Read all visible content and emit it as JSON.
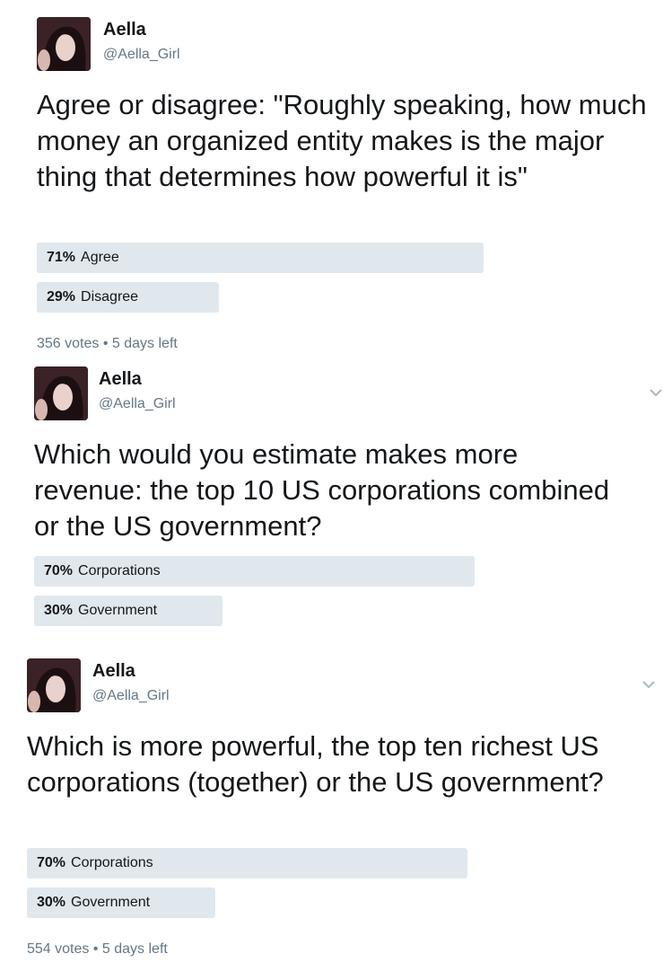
{
  "tweets": [
    {
      "author": {
        "name": "Aella",
        "handle": "@Aella_Girl"
      },
      "question": "Agree or disagree: \"Roughly speaking, how much money an organized entity makes is the major thing that determines how powerful it is\"",
      "options": [
        {
          "percent": "71%",
          "fraction": 0.71,
          "label": "Agree"
        },
        {
          "percent": "29%",
          "fraction": 0.29,
          "label": "Disagree"
        }
      ],
      "votes": "356 votes",
      "time_left": "5 days left",
      "has_caret": false
    },
    {
      "author": {
        "name": "Aella",
        "handle": "@Aella_Girl"
      },
      "question": "Which would you estimate makes more revenue: the top 10 US corporations combined or the US government?",
      "options": [
        {
          "percent": "70%",
          "fraction": 0.7,
          "label": "Corporations"
        },
        {
          "percent": "30%",
          "fraction": 0.3,
          "label": "Government"
        }
      ],
      "has_caret": true
    },
    {
      "author": {
        "name": "Aella",
        "handle": "@Aella_Girl"
      },
      "question": "Which is more powerful, the top ten richest US corporations (together) or the US government?",
      "options": [
        {
          "percent": "70%",
          "fraction": 0.7,
          "label": "Corporations"
        },
        {
          "percent": "30%",
          "fraction": 0.3,
          "label": "Government"
        }
      ],
      "votes": "554 votes",
      "time_left": "5 days left",
      "has_caret": true
    }
  ],
  "separator": "•",
  "icons": {
    "menu": "chevron-down-icon",
    "avatar": "profile-photo"
  },
  "colors": {
    "poll_bar": "#e1e8ed",
    "text": "#14171a",
    "secondary_text": "#657786",
    "caret": "#aab8c2"
  }
}
